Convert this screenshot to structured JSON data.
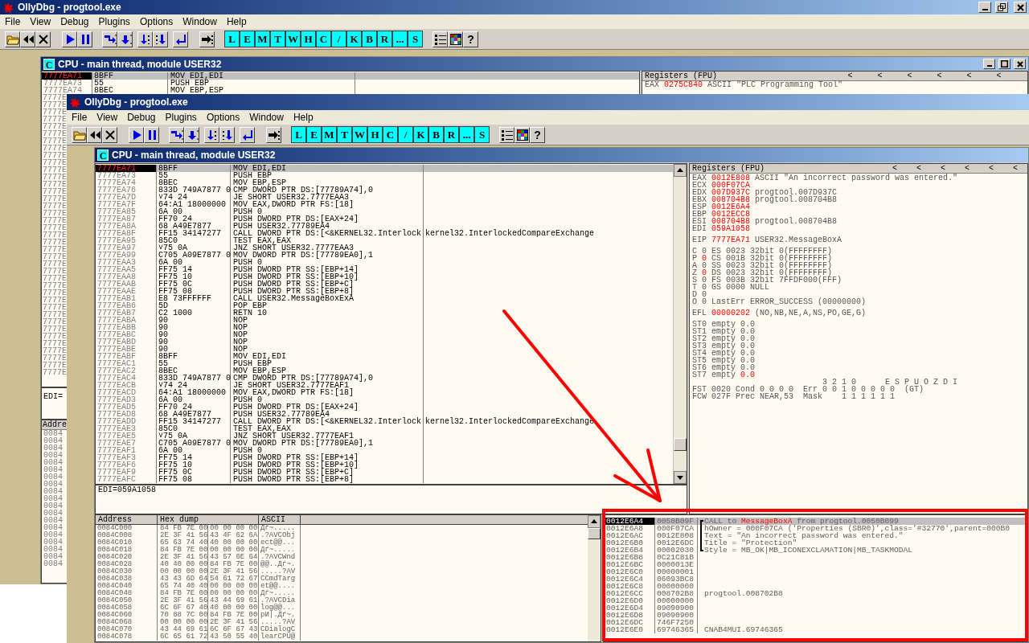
{
  "back_window": {
    "title": "OllyDbg - progtool.exe",
    "menu": [
      "File",
      "View",
      "Debug",
      "Plugins",
      "Options",
      "Window",
      "Help"
    ],
    "toolbar_letters": [
      "L",
      "E",
      "M",
      "T",
      "W",
      "H",
      "C",
      "/",
      "K",
      "B",
      "R",
      "...",
      "S"
    ],
    "help_button": "?",
    "cpu": {
      "icon_letter": "C",
      "title": "CPU - main thread, module USER32",
      "disasm_rows": [
        {
          "address": "7777EA71",
          "hex": "8BFF",
          "command": "MOV EDI,EDI",
          "selected": true
        },
        {
          "address": "7777EA73",
          "hex": "55",
          "command": "PUSH EBP",
          "selected": false
        },
        {
          "address": "7777EA74",
          "hex": "8BEC",
          "command": "MOV EBP,ESP",
          "selected": false
        }
      ],
      "address_stubs": [
        "7777E",
        "7777E",
        "7777E",
        "7777E",
        "7777E",
        "7777E",
        "7777E",
        "7777E",
        "7777E",
        "7777E",
        "7777E",
        "7777E",
        "7777E",
        "7777E",
        "7777E",
        "7777E",
        "7777E",
        "7777E",
        "7777E",
        "7777E",
        "7777E",
        "7777E",
        "7777E",
        "7777E",
        "7777E",
        "7777E",
        "7777E",
        "7777E",
        "7777E",
        "7777E",
        "7777E",
        "7777E",
        "7777E",
        "7777E",
        "7777E",
        "7777E",
        "7777E",
        "7777E",
        "7777E"
      ],
      "info_line": "EDI=",
      "dump_header": "Addre",
      "dump_stubs": [
        "0084",
        "0084",
        "0084",
        "0084",
        "0084",
        "0084",
        "0084",
        "0084",
        "0084",
        "0084",
        "0084",
        "0084",
        "0084",
        "0084",
        "0084",
        "0084",
        "0084",
        "0084",
        "0084"
      ],
      "registers_title": "Registers (FPU)",
      "register_arrows": [
        "<",
        "<",
        "<",
        "<",
        "<",
        "<"
      ],
      "register_lines": [
        {
          "label": "EAX",
          "value": "0275C840",
          "changed": true,
          "note": "ASCII \"PLC Programming Tool\""
        }
      ]
    }
  },
  "front_window": {
    "title": "OllyDbg - progtool.exe",
    "menu": [
      "File",
      "View",
      "Debug",
      "Plugins",
      "Options",
      "Window",
      "Help"
    ],
    "toolbar_letters": [
      "L",
      "E",
      "M",
      "T",
      "W",
      "H",
      "C",
      "/",
      "K",
      "B",
      "R",
      "...",
      "S"
    ],
    "help_button": "?",
    "cpu": {
      "icon_letter": "C",
      "title": "CPU - main thread, module USER32",
      "disasm_rows": [
        {
          "address": "7777EA71",
          "hex": "8BFF",
          "command": "MOV EDI,EDI",
          "selected": true
        },
        {
          "address": "7777EA73",
          "hex": "55",
          "command": "PUSH EBP",
          "selected": false
        },
        {
          "address": "7777EA74",
          "hex": "8BEC",
          "command": "MOV EBP,ESP",
          "selected": false
        },
        {
          "address": "7777EA76",
          "hex": "833D 749A7877 0",
          "command": "CMP DWORD PTR DS:[77789A74],0",
          "selected": false
        },
        {
          "address": "7777EA7D",
          "jump_mark": "˅",
          "hex": "74 24",
          "command": "JE SHORT USER32.7777EAA3",
          "selected": false
        },
        {
          "address": "7777EA7F",
          "hex": "64:A1 18000000",
          "command": "MOV EAX,DWORD PTR FS:[18]",
          "selected": false
        },
        {
          "address": "7777EA85",
          "hex": "6A 00",
          "command": "PUSH 0",
          "selected": false
        },
        {
          "address": "7777EA87",
          "hex": "FF70 24",
          "command": "PUSH DWORD PTR DS:[EAX+24]",
          "selected": false
        },
        {
          "address": "7777EA8A",
          "hex": "68 A49E7877",
          "command": "PUSH USER32.77789EA4",
          "selected": false
        },
        {
          "address": "7777EA8F",
          "hex": "FF15 34147277",
          "command": "CALL DWORD PTR DS:[<&KERNEL32.Interlock",
          "comment": "kernel32.InterlockedCompareExchange",
          "selected": false
        },
        {
          "address": "7777EA95",
          "hex": "85C0",
          "command": "TEST EAX,EAX",
          "selected": false
        },
        {
          "address": "7777EA97",
          "jump_mark": "˅",
          "hex": "75 0A",
          "command": "JNZ SHORT USER32.7777EAA3",
          "selected": false
        },
        {
          "address": "7777EA99",
          "hex": "C705 A09E7877 0",
          "command": "MOV DWORD PTR DS:[77789EA0],1",
          "selected": false
        },
        {
          "address": "7777EAA3",
          "hex": "6A 00",
          "command": "PUSH 0",
          "selected": false
        },
        {
          "address": "7777EAA5",
          "hex": "FF75 14",
          "command": "PUSH DWORD PTR SS:[EBP+14]",
          "selected": false
        },
        {
          "address": "7777EAA8",
          "hex": "FF75 10",
          "command": "PUSH DWORD PTR SS:[EBP+10]",
          "selected": false
        },
        {
          "address": "7777EAAB",
          "hex": "FF75 0C",
          "command": "PUSH DWORD PTR SS:[EBP+C]",
          "selected": false
        },
        {
          "address": "7777EAAE",
          "hex": "FF75 08",
          "command": "PUSH DWORD PTR SS:[EBP+8]",
          "selected": false
        },
        {
          "address": "7777EAB1",
          "hex": "E8 73FFFFFF",
          "command": "CALL USER32.MessageBoxExA",
          "selected": false
        },
        {
          "address": "7777EAB6",
          "hex": "5D",
          "command": "POP EBP",
          "selected": false
        },
        {
          "address": "7777EAB7",
          "hex": "C2 1000",
          "command": "RETN 10",
          "selected": false
        },
        {
          "address": "7777EABA",
          "hex": "90",
          "command": "NOP",
          "selected": false
        },
        {
          "address": "7777EABB",
          "hex": "90",
          "command": "NOP",
          "selected": false
        },
        {
          "address": "7777EABC",
          "hex": "90",
          "command": "NOP",
          "selected": false
        },
        {
          "address": "7777EABD",
          "hex": "90",
          "command": "NOP",
          "selected": false
        },
        {
          "address": "7777EABE",
          "hex": "90",
          "command": "NOP",
          "selected": false
        },
        {
          "address": "7777EABF",
          "hex": "8BFF",
          "command": "MOV EDI,EDI",
          "selected": false
        },
        {
          "address": "7777EAC1",
          "hex": "55",
          "command": "PUSH EBP",
          "selected": false
        },
        {
          "address": "7777EAC2",
          "hex": "8BEC",
          "command": "MOV EBP,ESP",
          "selected": false
        },
        {
          "address": "7777EAC4",
          "hex": "833D 749A7877 0",
          "command": "CMP DWORD PTR DS:[77789A74],0",
          "selected": false
        },
        {
          "address": "7777EACB",
          "jump_mark": "˅",
          "hex": "74 24",
          "command": "JE SHORT USER32.7777EAF1",
          "selected": false
        },
        {
          "address": "7777EACD",
          "hex": "64:A1 18000000",
          "command": "MOV EAX,DWORD PTR FS:[18]",
          "selected": false
        },
        {
          "address": "7777EAD3",
          "hex": "6A 00",
          "command": "PUSH 0",
          "selected": false
        },
        {
          "address": "7777EAD5",
          "hex": "FF70 24",
          "command": "PUSH DWORD PTR DS:[EAX+24]",
          "selected": false
        },
        {
          "address": "7777EAD8",
          "hex": "68 A49E7877",
          "command": "PUSH USER32.77789EA4",
          "selected": false
        },
        {
          "address": "7777EADD",
          "hex": "FF15 34147277",
          "command": "CALL DWORD PTR DS:[<&KERNEL32.Interlock",
          "comment": "kernel32.InterlockedCompareExchange",
          "selected": false
        },
        {
          "address": "7777EAE3",
          "hex": "85C0",
          "command": "TEST EAX,EAX",
          "selected": false
        },
        {
          "address": "7777EAE5",
          "jump_mark": "˅",
          "hex": "75 0A",
          "command": "JNZ SHORT USER32.7777EAF1",
          "selected": false
        },
        {
          "address": "7777EAE7",
          "hex": "C705 A09E7877 0",
          "command": "MOV DWORD PTR DS:[77789EA0],1",
          "selected": false
        },
        {
          "address": "7777EAF1",
          "hex": "6A 00",
          "command": "PUSH 0",
          "selected": false
        },
        {
          "address": "7777EAF3",
          "hex": "FF75 14",
          "command": "PUSH DWORD PTR SS:[EBP+14]",
          "selected": false
        },
        {
          "address": "7777EAF6",
          "hex": "FF75 10",
          "command": "PUSH DWORD PTR SS:[EBP+10]",
          "selected": false
        },
        {
          "address": "7777EAF9",
          "hex": "FF75 0C",
          "command": "PUSH DWORD PTR SS:[EBP+C]",
          "selected": false
        },
        {
          "address": "7777EAFC",
          "hex": "FF75 08",
          "command": "PUSH DWORD PTR SS:[EBP+8]",
          "selected": false
        }
      ],
      "info_line": "EDI=059A1058",
      "registers_title": "Registers (FPU)",
      "register_arrows": [
        "<",
        "<",
        "<",
        "<",
        "<",
        "<"
      ],
      "register_groups": [
        [
          {
            "label": "EAX",
            "value": "0012E808",
            "changed": true,
            "note": "ASCII \"An incorrect password was entered.\""
          },
          {
            "label": "ECX",
            "value": "000F07CA",
            "changed": true
          },
          {
            "label": "EDX",
            "value": "007D937C",
            "changed": true,
            "note": "progtool.007D937C"
          },
          {
            "label": "EBX",
            "value": "008704B8",
            "changed": true,
            "note": "progtool.008704B8"
          },
          {
            "label": "ESP",
            "value": "0012E6A4",
            "changed": true
          },
          {
            "label": "EBP",
            "value": "0012ECC8",
            "changed": true
          },
          {
            "label": "ESI",
            "value": "008704B8",
            "changed": true,
            "note": "progtool.008704B8"
          },
          {
            "label": "EDI",
            "value": "059A1058",
            "changed": true
          }
        ],
        [
          {
            "label": "EIP",
            "value": "7777EA71",
            "changed": true,
            "note": "USER32.MessageBoxA"
          }
        ],
        [
          {
            "label": "C",
            "value": "0",
            "changed": false,
            "note": "ES 0023 32bit 0(FFFFFFFF)"
          },
          {
            "label": "P",
            "value": "0",
            "changed": true,
            "note": "CS 001B 32bit 0(FFFFFFFF)"
          },
          {
            "label": "A",
            "value": "0",
            "changed": false,
            "note": "SS 0023 32bit 0(FFFFFFFF)"
          },
          {
            "label": "Z",
            "value": "0",
            "changed": true,
            "note": "DS 0023 32bit 0(FFFFFFFF)"
          },
          {
            "label": "S",
            "value": "0",
            "changed": false,
            "note": "FS 003B 32bit 7FFDF000(FFF)"
          },
          {
            "label": "T",
            "value": "0",
            "changed": false,
            "note": "GS 0000 NULL"
          },
          {
            "label": "D",
            "value": "0",
            "changed": false
          },
          {
            "label": "O",
            "value": "0",
            "changed": false,
            "note": "LastErr ERROR_SUCCESS (00000000)"
          }
        ],
        [
          {
            "label": "EFL",
            "value": "00000202",
            "changed": true,
            "note": "(NO,NB,NE,A,NS,PO,GE,G)"
          }
        ],
        [
          {
            "label": "ST0 empty",
            "value": "0.0",
            "changed": false
          },
          {
            "label": "ST1 empty",
            "value": "0.0",
            "changed": false
          },
          {
            "label": "ST2 empty",
            "value": "0.0",
            "changed": false
          },
          {
            "label": "ST3 empty",
            "value": "0.0",
            "changed": false
          },
          {
            "label": "ST4 empty",
            "value": "0.0",
            "changed": false
          },
          {
            "label": "ST5 empty",
            "value": "0.0",
            "changed": false
          },
          {
            "label": "ST6 empty",
            "value": "0.0",
            "changed": false
          },
          {
            "label": "ST7 empty",
            "value": "0.0",
            "changed": true
          },
          {
            "note": "3 2 1 0      E S P U O Z D I"
          },
          {
            "label": "FST",
            "value": "0020",
            "changed": false,
            "note": "Cond 0 0 0 0  Err 0 0 1 0 0 0 0 0  (GT)"
          },
          {
            "label": "FCW",
            "value": "027F",
            "changed": false,
            "note": "Prec NEAR,53  Mask    1 1 1 1 1 1"
          }
        ]
      ],
      "dump": {
        "columns": [
          "Address",
          "Hex dump",
          "ASCII"
        ],
        "rows": [
          {
            "address": "0084C000",
            "hex_1": "84 FB 7E 00",
            "hex_2": "00 00 00 00",
            "ascii": "Дѓ~....."
          },
          {
            "address": "0084C008",
            "hex_1": "2E 3F 41 56",
            "hex_2": "43 4F 62 6A",
            "ascii": ".?AVCObj"
          },
          {
            "address": "0084C010",
            "hex_1": "65 63 74 40",
            "hex_2": "40 00 00 00",
            "ascii": "ect@@..."
          },
          {
            "address": "0084C018",
            "hex_1": "84 FB 7E 00",
            "hex_2": "00 00 00 00",
            "ascii": "Дѓ~....."
          },
          {
            "address": "0084C020",
            "hex_1": "2E 3F 41 56",
            "hex_2": "43 57 6E 64",
            "ascii": ".?AVCWnd"
          },
          {
            "address": "0084C028",
            "hex_1": "40 40 00 00",
            "hex_2": "84 FB 7E 00",
            "ascii": "@@..Дѓ~."
          },
          {
            "address": "0084C030",
            "hex_1": "00 00 00 00",
            "hex_2": "2E 3F 41 56",
            "ascii": ".....?AV"
          },
          {
            "address": "0084C038",
            "hex_1": "43 43 6D 64",
            "hex_2": "54 61 72 67",
            "ascii": "CCmdTarg"
          },
          {
            "address": "0084C040",
            "hex_1": "65 74 40 40",
            "hex_2": "00 00 00 00",
            "ascii": "et@@...."
          },
          {
            "address": "0084C048",
            "hex_1": "84 FB 7E 00",
            "hex_2": "00 00 00 00",
            "ascii": "Дѓ~....."
          },
          {
            "address": "0084C050",
            "hex_1": "2E 3F 41 56",
            "hex_2": "43 44 69 61",
            "ascii": ".?AVCDia"
          },
          {
            "address": "0084C058",
            "hex_1": "6C 6F 67 40",
            "hex_2": "40 00 00 00",
            "ascii": "log@@..."
          },
          {
            "address": "0084C060",
            "hex_1": "70 88 7C 00",
            "hex_2": "84 FB 7E 00",
            "ascii": "pИ|.Дѓ~."
          },
          {
            "address": "0084C068",
            "hex_1": "00 00 00 00",
            "hex_2": "2E 3F 41 56",
            "ascii": ".....?AV"
          },
          {
            "address": "0084C070",
            "hex_1": "43 44 69 61",
            "hex_2": "6C 6F 67 43",
            "ascii": "CDialogC"
          },
          {
            "address": "0084C078",
            "hex_1": "6C 65 61 72",
            "hex_2": "43 50 55 40",
            "ascii": "learCPU@"
          }
        ]
      },
      "stack": {
        "rows": [
          {
            "address": "0012E6A4",
            "value": "0050B09F",
            "comment_parts": [
              {
                "text": "CALL to ",
                "highlight": false
              },
              {
                "text": "MessageBoxA",
                "highlight": true
              },
              {
                "text": " from progtool.0050B099",
                "highlight": false
              }
            ],
            "argument_bracket": true,
            "selected": true
          },
          {
            "address": "0012E6A8",
            "value": "000F07CA",
            "comment": "hOwner = 000F07CA ('Properties (SBR0)',class='#32770',parent=000B0",
            "argument_bracket": true,
            "selected": false
          },
          {
            "address": "0012E6AC",
            "value": "0012E808",
            "comment": "Text = \"An incorrect password was entered.\"",
            "argument_bracket": true,
            "selected": false
          },
          {
            "address": "0012E6B0",
            "value": "0012E6DC",
            "comment": "Title = \"Protection\"",
            "argument_bracket": true,
            "selected": false
          },
          {
            "address": "0012E6B4",
            "value": "00002030",
            "comment": "Style = MB_OK|MB_ICONEXCLAMATION|MB_TASKMODAL",
            "argument_bracket": true,
            "selected": false
          },
          {
            "address": "0012E6B8",
            "value": "0C21C81B",
            "argument_bracket": false,
            "selected": false
          },
          {
            "address": "0012E6BC",
            "value": "0000013E",
            "argument_bracket": false,
            "selected": false
          },
          {
            "address": "0012E6C0",
            "value": "00000001",
            "argument_bracket": false,
            "selected": false
          },
          {
            "address": "0012E6C4",
            "value": "06093BC8",
            "argument_bracket": false,
            "selected": false
          },
          {
            "address": "0012E6C8",
            "value": "00000000",
            "argument_bracket": false,
            "selected": false
          },
          {
            "address": "0012E6CC",
            "value": "008702B8",
            "comment": "progtool.008702B8",
            "argument_bracket": false,
            "selected": false
          },
          {
            "address": "0012E6D0",
            "value": "00000000",
            "argument_bracket": false,
            "selected": false
          },
          {
            "address": "0012E6D4",
            "value": "09090900",
            "argument_bracket": false,
            "selected": false
          },
          {
            "address": "0012E6D8",
            "value": "09090900",
            "argument_bracket": false,
            "selected": false
          },
          {
            "address": "0012E6DC",
            "value": "746F7250",
            "argument_bracket": false,
            "selected": false
          },
          {
            "address": "0012E6E0",
            "value": "69746365",
            "comment": "CNAB4MUI.69746365",
            "argument_bracket": false,
            "selected": false
          }
        ]
      }
    }
  }
}
